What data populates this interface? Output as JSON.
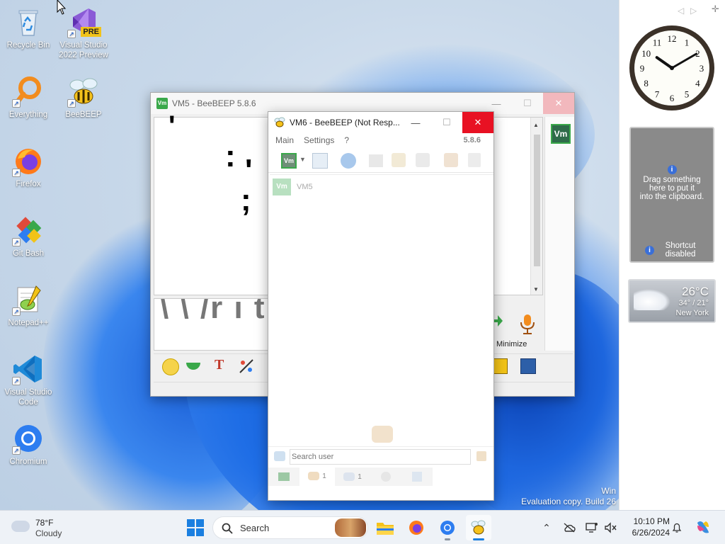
{
  "desktop_icons": [
    {
      "label": "Recycle Bin",
      "icon": "recycle-bin-icon"
    },
    {
      "label": "Visual Studio 2022 Preview",
      "icon": "visual-studio-preview-icon",
      "badge": "PRE"
    },
    {
      "label": "Everything",
      "icon": "everything-search-icon"
    },
    {
      "label": "BeeBEEP",
      "icon": "beebeep-bee-icon"
    },
    {
      "label": "Firefox",
      "icon": "firefox-icon"
    },
    {
      "label": "Git Bash",
      "icon": "git-bash-icon"
    },
    {
      "label": "Notepad++",
      "icon": "notepad-plus-plus-icon"
    },
    {
      "label": "Visual Studio Code",
      "icon": "vscode-icon"
    },
    {
      "label": "Chromium",
      "icon": "chromium-icon"
    }
  ],
  "watermark": {
    "line1": "Win",
    "line2": "Evaluation copy. Build 26"
  },
  "vm5_window": {
    "title": "VM5 - BeeBEEP 5.8.6",
    "user_badge": "Vm",
    "minimize_label": "Minimize",
    "glyph_chars": [
      "'",
      ":",
      "'",
      ";"
    ],
    "big_text": "\\ \\ /r i t"
  },
  "vm6_window": {
    "title": "VM6 - BeeBEEP (Not Resp...",
    "menu": [
      "Main",
      "Settings",
      "?"
    ],
    "version": "5.8.6",
    "user_list": [
      {
        "avatar": "Vm",
        "name": "VM5"
      }
    ],
    "search_placeholder": "Search user",
    "bottom_tabs": [
      {
        "icon": "chat-icon",
        "count": ""
      },
      {
        "icon": "users-icon",
        "count": "1"
      },
      {
        "icon": "groups-icon",
        "count": "1"
      },
      {
        "icon": "plugins-icon",
        "count": ""
      },
      {
        "icon": "tools-icon",
        "count": ""
      }
    ]
  },
  "sidebar": {
    "clipboard": {
      "line1": "Drag something",
      "line2": "here to put it",
      "line3": "into the clipboard.",
      "shortcut1": "Shortcut",
      "shortcut2": "disabled"
    },
    "weather": {
      "temp": "26°C",
      "range": "34° / 21°",
      "city": "New York"
    },
    "clock": {
      "hours": 10,
      "minutes": 10
    }
  },
  "taskbar": {
    "weather_temp": "78°F",
    "weather_desc": "Cloudy",
    "search_label": "Search",
    "time": "10:10 PM",
    "date": "6/26/2024"
  },
  "colors": {
    "accent_green": "#3aa84a",
    "close_red": "#e81123",
    "taskbar_bg": "#eef2f7"
  }
}
